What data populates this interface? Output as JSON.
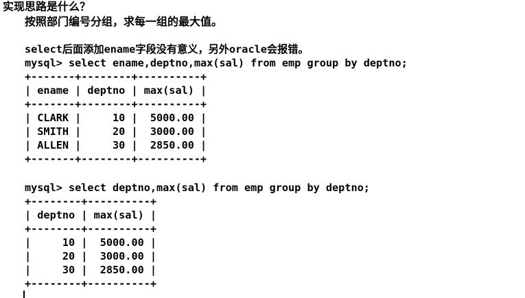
{
  "heading": {
    "question": "实现思路是什么？",
    "answer": "按照部门编号分组，求每一组的最大值。"
  },
  "note": "select后面添加ename字段没有意义，另外oracle会报错。",
  "query1": {
    "prompt": "mysql> select ename,deptno,max(sal) from emp group by deptno;",
    "border": "+-------+--------+----------+",
    "header": "| ename | deptno | max(sal) |",
    "rows": [
      "| CLARK |     10 |  5000.00 |",
      "| SMITH |     20 |  3000.00 |",
      "| ALLEN |     30 |  2850.00 |"
    ]
  },
  "query2": {
    "prompt": "mysql> select deptno,max(sal) from emp group by deptno;",
    "border": "+--------+----------+",
    "header": "| deptno | max(sal) |",
    "rows": [
      "|     10 |  5000.00 |",
      "|     20 |  3000.00 |",
      "|     30 |  2850.00 |"
    ]
  }
}
